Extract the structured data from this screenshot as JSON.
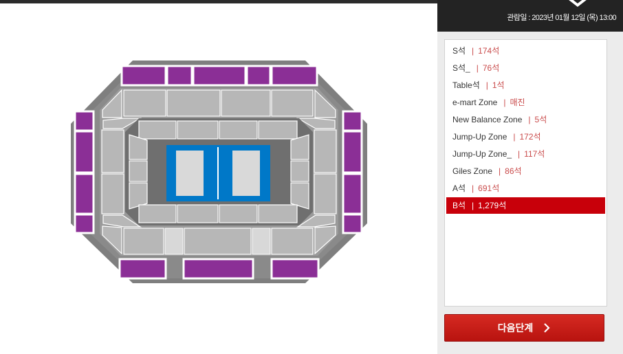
{
  "panel": {
    "date_line": "관람일 : 2023년 01월 12일 (목) 13:00",
    "emblem_icon": "chevron-emblem-icon"
  },
  "grades": [
    {
      "name": "S석",
      "count": "174석",
      "selected": false
    },
    {
      "name": "S석_",
      "count": "76석",
      "selected": false
    },
    {
      "name": "Table석",
      "count": "1석",
      "selected": false
    },
    {
      "name": "e-mart Zone",
      "count": "매진",
      "selected": false
    },
    {
      "name": "New Balance Zone",
      "count": "5석",
      "selected": false
    },
    {
      "name": "Jump-Up Zone",
      "count": "172석",
      "selected": false
    },
    {
      "name": "Jump-Up Zone_",
      "count": "117석",
      "selected": false
    },
    {
      "name": "Giles Zone",
      "count": "86석",
      "selected": false
    },
    {
      "name": "A석",
      "count": "691석",
      "selected": false
    },
    {
      "name": "B석",
      "count": "1,279석",
      "selected": true
    }
  ],
  "separator": "|",
  "next_button": {
    "label": "다음단계",
    "icon": "chevron-right-icon"
  },
  "colors": {
    "accent": "#c8000a",
    "purple_section": "#8b2f96",
    "gray_section": "#b7b7b7",
    "court": "#0078c8"
  }
}
